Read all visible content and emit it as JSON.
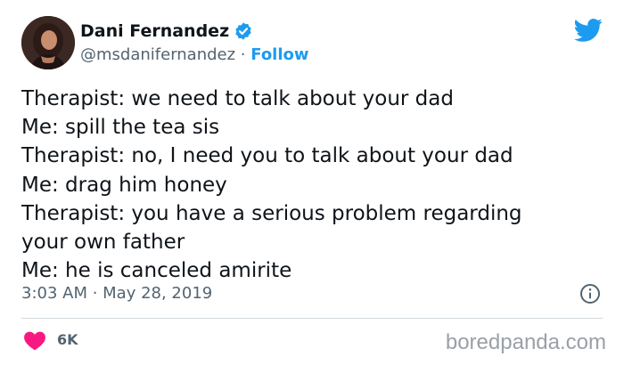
{
  "author": {
    "display_name": "Dani Fernandez",
    "handle": "@msdanifernandez",
    "separator": " · ",
    "follow_label": "Follow",
    "verified": true
  },
  "tweet": {
    "lines": [
      "Therapist: we need to talk about your dad",
      "Me: spill the tea sis",
      "Therapist: no, I need you to talk about your dad",
      "Me: drag him honey",
      "Therapist: you have a serious problem regarding",
      "your own father",
      "Me: he is canceled amirite"
    ],
    "timestamp": "3:03 AM · May 28, 2019"
  },
  "engagement": {
    "likes": "6K"
  },
  "watermark": "boredpanda.com",
  "icons": {
    "logo": "twitter-bird-icon",
    "verified": "verified-badge-icon",
    "info": "info-icon",
    "like": "heart-icon"
  },
  "colors": {
    "accent": "#1d9bf0",
    "heart": "#f91880",
    "text": "#0f1419",
    "secondary": "#536471",
    "divider": "#cfd9de",
    "watermark": "#9aa0a6"
  }
}
